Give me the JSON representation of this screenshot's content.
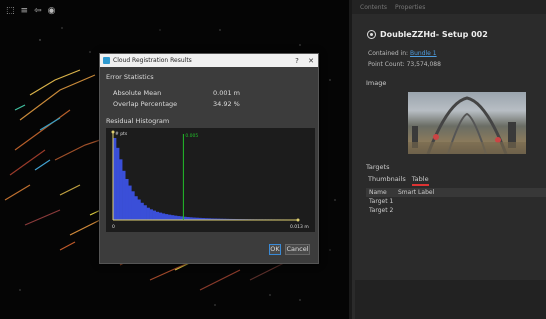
{
  "viewport": {
    "toolbar_icons": [
      "grid-icon",
      "expand-icon",
      "eye-icon"
    ]
  },
  "right_panel": {
    "tabs": [
      "Contents",
      "Properties"
    ],
    "title": "DoubleZZHd- Setup 002",
    "contained_in_label": "Contained in:",
    "contained_in_value": "Bundle 1",
    "point_count_label": "Point Count:",
    "point_count_value": "73,574,088",
    "image_label": "Image",
    "targets_label": "Targets",
    "targets_tabs": [
      "Thumbnails",
      "Table"
    ],
    "table_headers": [
      "Name",
      "Smart Label"
    ],
    "table_rows": [
      [
        "Target 1",
        ""
      ],
      [
        "Target 2",
        ""
      ]
    ]
  },
  "dialog": {
    "title": "Cloud Registration Results",
    "help_symbol": "?",
    "close_symbol": "✕",
    "error_stats_title": "Error Statistics",
    "absolute_mean_label": "Absolute Mean",
    "absolute_mean_value": "0.001 m",
    "overlap_label": "Overlap Percentage",
    "overlap_value": "34.92 %",
    "histogram_title": "Residual Histogram",
    "ok_label": "OK",
    "cancel_label": "Cancel"
  },
  "chart_data": {
    "type": "bar",
    "title": "Residual Histogram",
    "ylabel": "# pts",
    "x_tick_labels": [
      "0",
      "0.013 m"
    ],
    "x_range": [
      0,
      0.013
    ],
    "marker_value": 0.005,
    "marker_label": "0.005",
    "series_color": "#3a4fd8",
    "marker_color": "#22c02a",
    "values": [
      100,
      88,
      74,
      60,
      50,
      42,
      35,
      29,
      25,
      21,
      18,
      15,
      13,
      11.5,
      10,
      9,
      8,
      7.2,
      6.5,
      5.9,
      5.3,
      4.8,
      4.4,
      4.0,
      3.6,
      3.3,
      3.0,
      2.8,
      2.6,
      2.4,
      2.2,
      2.1,
      1.9,
      1.8,
      1.7,
      1.6,
      1.5,
      1.4,
      1.3,
      1.25,
      1.2,
      1.15,
      1.1,
      1.05,
      1.0,
      0.95,
      0.9,
      0.88,
      0.85,
      0.82,
      0.8,
      0.78,
      0.75,
      0.72,
      0.7,
      0.68,
      0.66,
      0.64,
      0.62,
      0.6
    ]
  }
}
